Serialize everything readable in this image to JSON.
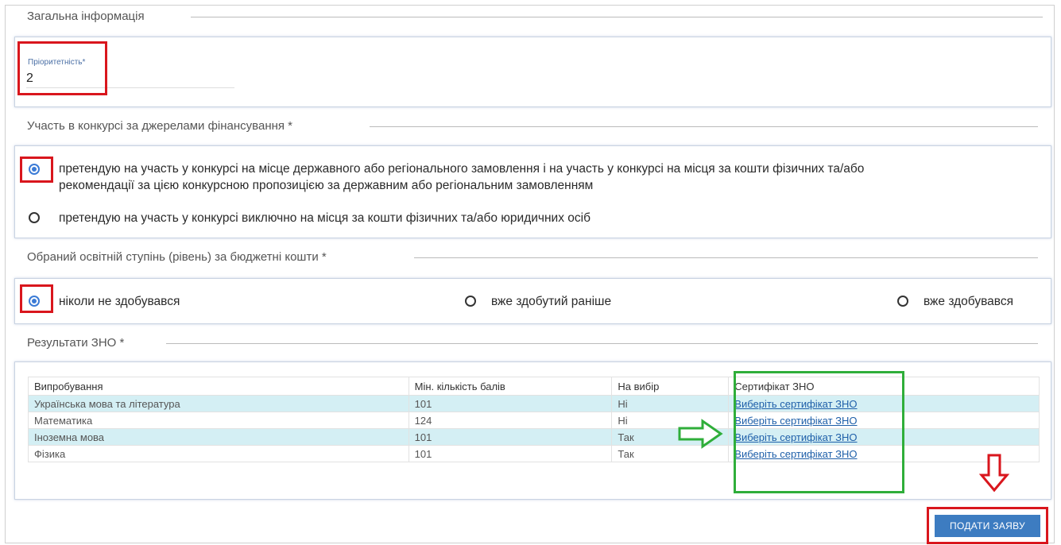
{
  "general": {
    "legend": "Загальна інформація",
    "priority_label": "Пріоритетність*",
    "priority_value": "2"
  },
  "funding": {
    "legend": "Участь в конкурсі за джерелами фінансування *",
    "option1_line1": "претендую на участь у конкурсі на місце державного або регіонального замовлення і на участь у конкурсі на місця за кошти фізичних та/або",
    "option1_line2": "рекомендації за цією конкурсною пропозицією за державним або регіональним замовленням",
    "option2": "претендую на участь у конкурсі виключно на місця за кошти фізичних та/або юридичних осіб",
    "selected": 1
  },
  "degree": {
    "legend": "Обраний освітній ступінь (рівень) за бюджетні кошти *",
    "options": [
      "ніколи не здобувався",
      "вже здобутий раніше",
      "вже здобувався"
    ],
    "selected": 0
  },
  "zno": {
    "legend": "Результати ЗНО *",
    "headers": [
      "Випробування",
      "Мін. кількість балів",
      "На вибір",
      "Сертифікат ЗНО"
    ],
    "rows": [
      [
        "Українська мова та література",
        "101",
        "Ні",
        "Виберіть сертифікат ЗНО"
      ],
      [
        "Математика",
        "124",
        "Ні",
        "Виберіть сертифікат ЗНО"
      ],
      [
        "Іноземна мова",
        "101",
        "Так",
        "Виберіть сертифікат ЗНО"
      ],
      [
        "Фізика",
        "101",
        "Так",
        "Виберіть сертифікат ЗНО"
      ]
    ]
  },
  "submit_label": "ПОДАТИ ЗАЯВУ",
  "colors": {
    "accent": "#3d7cc1",
    "highlight_red": "#d9161d",
    "highlight_green": "#2fae3a",
    "row_alt": "#d4eff4"
  },
  "icons": [
    "arrow-right-icon",
    "arrow-down-icon"
  ]
}
